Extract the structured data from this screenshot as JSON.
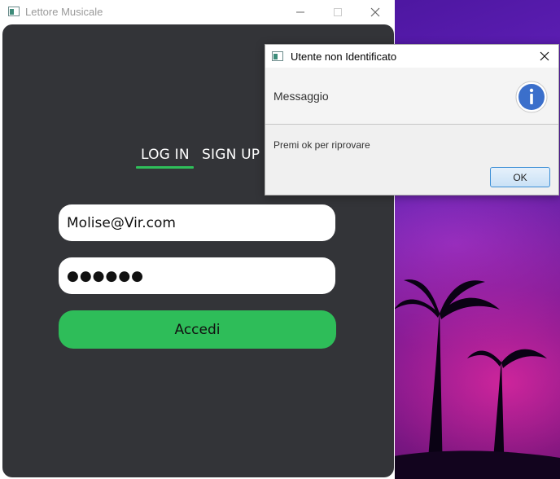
{
  "main_window": {
    "title": "Lettore Musicale",
    "tabs": {
      "login": "LOG IN",
      "signup": "SIGN UP"
    },
    "email_value": "Molise@Vir.com",
    "password_value": "●●●●●●",
    "submit_label": "Accedi"
  },
  "dialog": {
    "title": "Utente non Identificato",
    "heading": "Messaggio",
    "message": "Premi ok per riprovare",
    "ok_label": "OK"
  },
  "colors": {
    "panel": "#333438",
    "accent_green": "#2ebd59",
    "info_blue": "#3b6fcb"
  }
}
